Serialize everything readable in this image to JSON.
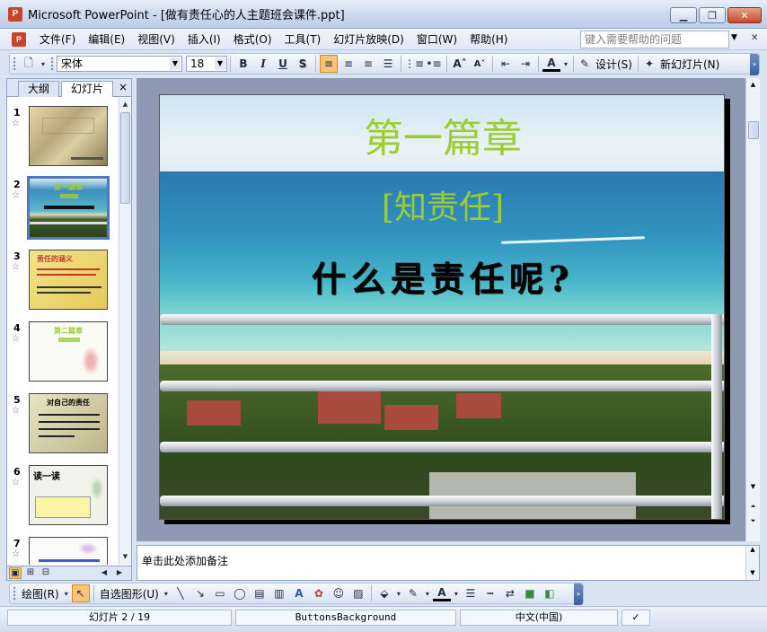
{
  "window": {
    "title": "Microsoft PowerPoint - [做有责任心的人主题班会课件.ppt]",
    "app_icon_letter": "P"
  },
  "menu": {
    "items": [
      "文件(F)",
      "编辑(E)",
      "视图(V)",
      "插入(I)",
      "格式(O)",
      "工具(T)",
      "幻灯片放映(D)",
      "窗口(W)",
      "帮助(H)"
    ],
    "help_placeholder": "键入需要帮助的问题"
  },
  "toolbar": {
    "font_name": "宋体",
    "font_size": "18",
    "bold": "B",
    "italic": "I",
    "underline": "U",
    "shadow": "S",
    "design_label": "设计(S)",
    "new_slide_label": "新幻灯片(N)"
  },
  "left_pane": {
    "tab_outline": "大纲",
    "tab_slides": "幻灯片",
    "close": "×",
    "thumbnails": [
      {
        "num": "1",
        "title": "",
        "selected": false
      },
      {
        "num": "2",
        "title": "第一篇章",
        "selected": true
      },
      {
        "num": "3",
        "title": "责任的涵义",
        "selected": false
      },
      {
        "num": "4",
        "title": "第二篇章",
        "selected": false
      },
      {
        "num": "5",
        "title": "对自己的责任",
        "selected": false
      },
      {
        "num": "6",
        "title": "读一读",
        "selected": false
      },
      {
        "num": "7",
        "title": "",
        "selected": false
      }
    ]
  },
  "slide": {
    "heading": "第一篇章",
    "subheading": "[知责任]",
    "question": "什么是责任呢?"
  },
  "notes": {
    "placeholder": "单击此处添加备注"
  },
  "drawing_toolbar": {
    "draw_label": "绘图(R)",
    "autoshapes_label": "自选图形(U)"
  },
  "status": {
    "slide_position": "幻灯片 2 / 19",
    "design_template": "ButtonsBackground",
    "language": "中文(中国)"
  }
}
